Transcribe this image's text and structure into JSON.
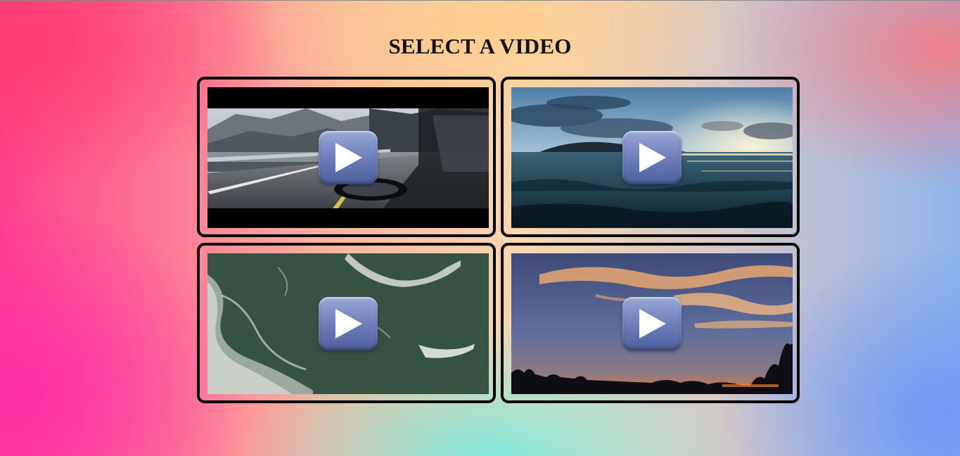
{
  "page": {
    "title": "SELECT A VIDEO"
  },
  "videos": [
    {
      "scene": "rainy-mountain-road",
      "icon": "play-icon"
    },
    {
      "scene": "ocean-sunset",
      "icon": "play-icon"
    },
    {
      "scene": "aerial-ocean-waves",
      "icon": "play-icon"
    },
    {
      "scene": "twilight-sky",
      "icon": "play-icon"
    }
  ],
  "colors": {
    "card_border": "#000000",
    "play_button": "#6f80bb",
    "title_text": "#111111"
  }
}
